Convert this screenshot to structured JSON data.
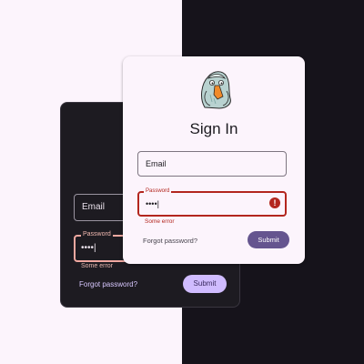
{
  "dark_card": {
    "email_placeholder": "Email",
    "password_label": "Password",
    "password_value": "••••|",
    "error_text": "Some error",
    "forgot_link": "Forgot password?",
    "submit_label": "Submit"
  },
  "light_card": {
    "title": "Sign In",
    "email_placeholder": "Email",
    "password_label": "Password",
    "password_value": "••••|",
    "error_icon": "!",
    "error_text": "Some error",
    "forgot_link": "Forgot password?",
    "submit_label": "Submit",
    "mascot_icon": "pigeon-mascot-icon"
  },
  "colors": {
    "error": "#b3261e",
    "primary": "#65558f",
    "primary_dark_theme": "#d0bcff",
    "dark_background": "#16131b"
  }
}
